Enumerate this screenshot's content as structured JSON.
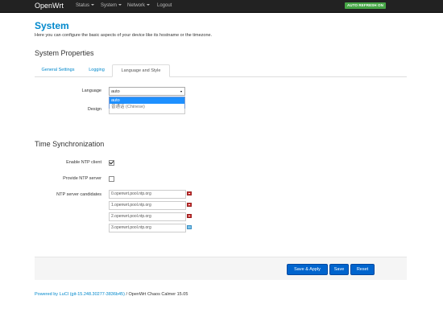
{
  "navbar": {
    "brand": "OpenWrt",
    "menus": [
      {
        "label": "Status"
      },
      {
        "label": "System"
      },
      {
        "label": "Network"
      }
    ],
    "logout": "Logout",
    "autorefresh": "AUTO REFRESH ON"
  },
  "page": {
    "title": "System",
    "description": "Here you can configure the basic aspects of your device like its hostname or the timezone."
  },
  "system_properties": {
    "title": "System Properties",
    "tabs": [
      "General Settings",
      "Logging",
      "Language and Style"
    ],
    "active_tab": "Language and Style",
    "language_label": "Language",
    "language_value": "auto",
    "language_options": [
      "auto",
      "普通话 (Chinese)"
    ],
    "design_label": "Design"
  },
  "time_sync": {
    "title": "Time Synchronization",
    "enable_ntp_label": "Enable NTP client",
    "enable_ntp_checked": true,
    "provide_ntp_label": "Provide NTP server",
    "provide_ntp_checked": false,
    "ntp_servers_label": "NTP server candidates",
    "ntp_servers": [
      "0.openwrt.pool.ntp.org",
      "1.openwrt.pool.ntp.org",
      "2.openwrt.pool.ntp.org",
      "3.openwrt.pool.ntp.org"
    ]
  },
  "actions": {
    "save_apply": "Save & Apply",
    "save": "Save",
    "reset": "Reset"
  },
  "footer": {
    "link": "Powered by LuCI (git-15.248.30277-3836b45)",
    "text": " / OpenWrt Chaos Calmer 15.05"
  },
  "colors": {
    "accent": "#0088cc",
    "button": "#0064cd",
    "navbar": "#222222",
    "autorefresh": "#46a546"
  }
}
